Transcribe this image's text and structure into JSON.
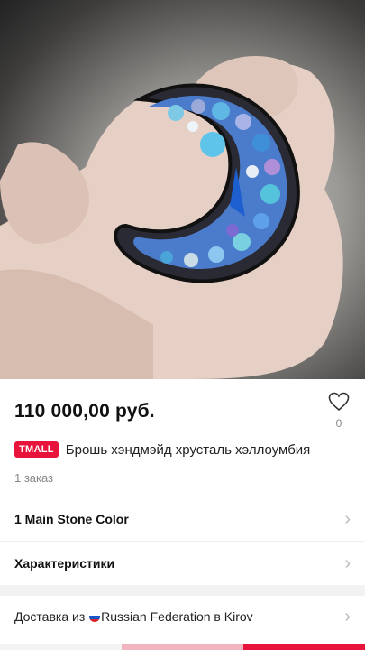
{
  "product": {
    "price": "110 000,00 руб.",
    "favorite_count": "0",
    "badge": "TMALL",
    "title": "Брошь хэндмэйд хрусталь хэллоумбия",
    "orders": "1 заказ"
  },
  "rows": {
    "color": "1 Main Stone Color",
    "specs": "Характеристики",
    "delivery_prefix": "Доставка из ",
    "delivery_rest": "Russian Federation в Kirov"
  },
  "icons": {
    "favorite": "heart-outline-icon",
    "chevron": "chevron-right-icon",
    "flag": "russia-flag-icon"
  },
  "colors": {
    "tmall": "#e8143c",
    "accent": "#e8143c"
  }
}
